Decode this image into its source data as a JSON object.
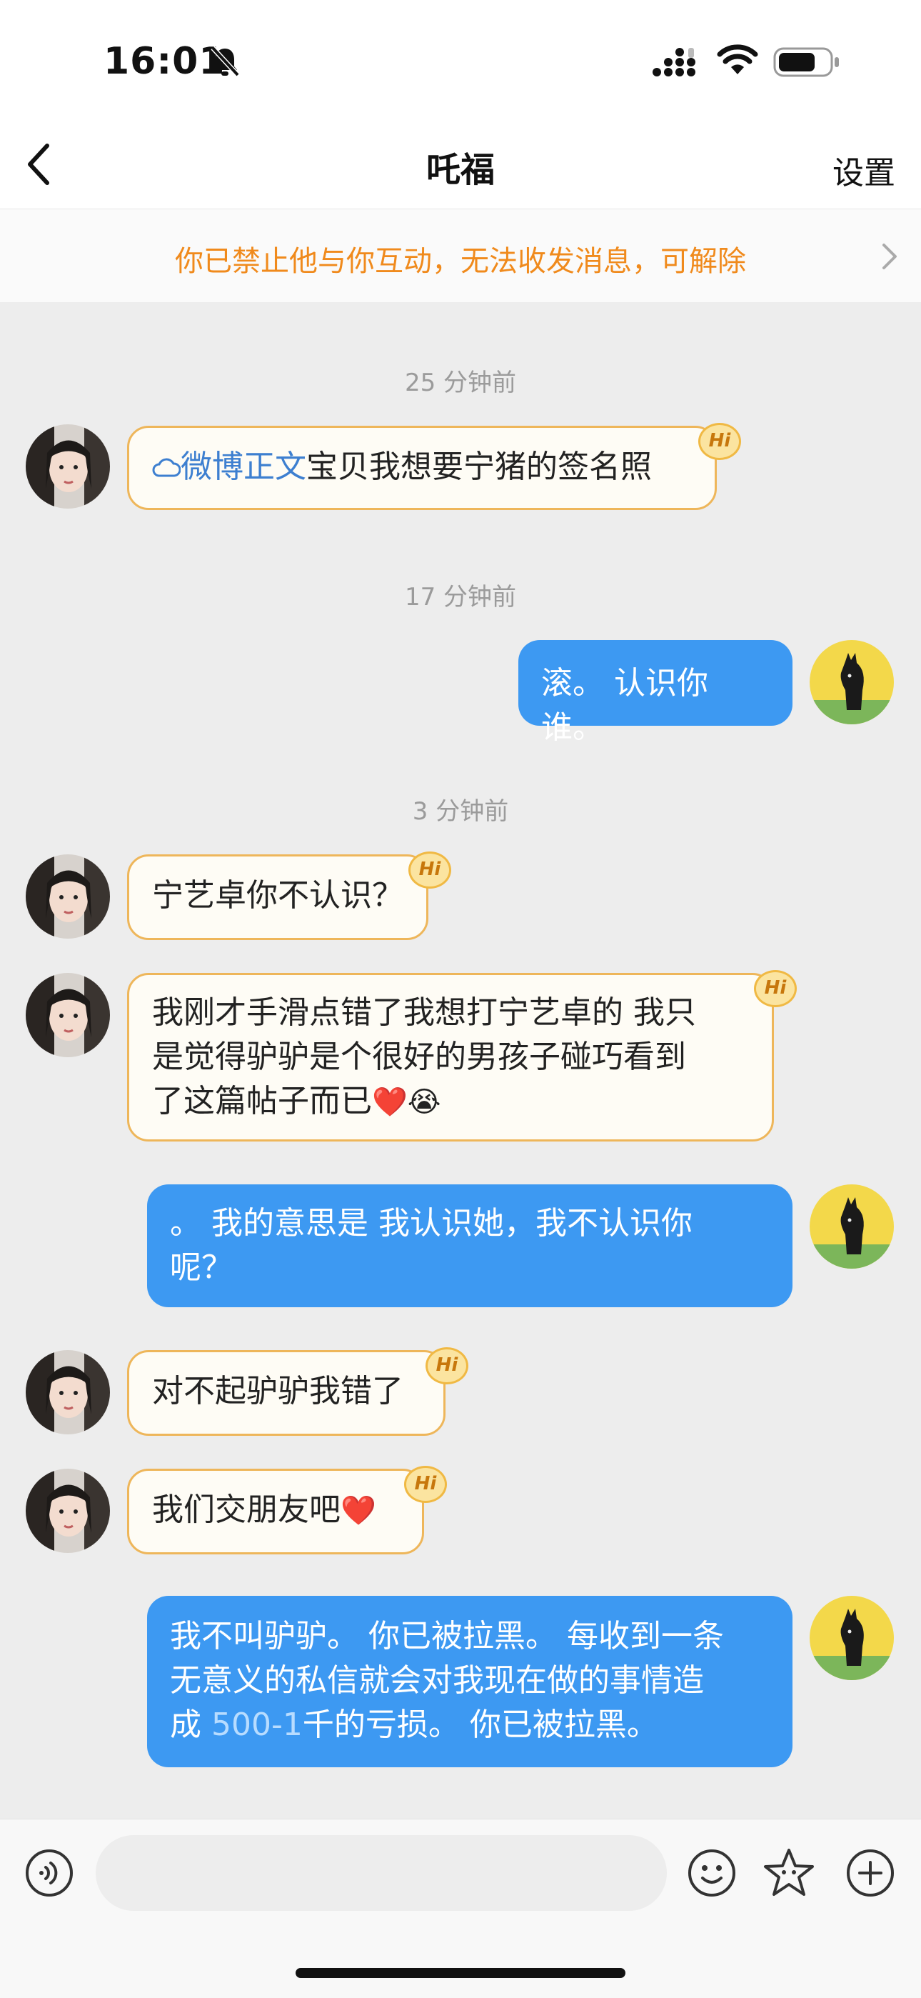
{
  "status_bar": {
    "time": "16:01"
  },
  "header": {
    "title": "吒福",
    "settings_label": "设置"
  },
  "banner": {
    "text": "你已禁止他与你互动，无法收发消息，可解除"
  },
  "messages": [
    {
      "timestamp": "25 分钟前"
    },
    {
      "side": "in",
      "link": "微博正文",
      "text": "宝贝我想要宁猪的签名照",
      "badge": "Hi"
    },
    {
      "timestamp": "17 分钟前"
    },
    {
      "side": "out",
      "text": "滚。 认识你谁。"
    },
    {
      "timestamp": "3 分钟前"
    },
    {
      "side": "in",
      "text": "宁艺卓你不认识？",
      "badge": "Hi"
    },
    {
      "side": "in",
      "line1": "我刚才手滑点错了我想打宁艺卓的 我只",
      "line2": "是觉得驴驴是个很好的男孩子碰巧看到",
      "line3": "了这篇帖子而已",
      "emojis": "❤️😭",
      "badge": "Hi"
    },
    {
      "side": "out",
      "line1": "。 我的意思是 我认识她，我不认识你",
      "line2": "呢？"
    },
    {
      "side": "in",
      "text": "对不起驴驴我错了",
      "badge": "Hi"
    },
    {
      "side": "in",
      "text": "我们交朋友吧",
      "emojis": "❤️",
      "badge": "Hi"
    },
    {
      "side": "out",
      "line1": "我不叫驴驴。 你已被拉黑。 每收到一条",
      "line2": "无意义的私信就会对我现在做的事情造",
      "line3_pre": "成 ",
      "line3_num": "500-1",
      "line3_post": "千的亏损。 你已被拉黑。"
    }
  ],
  "colors": {
    "incoming_border": "#eeb65a",
    "outgoing_bg": "#3d99f2",
    "banner_text": "#f08a1c"
  },
  "icons": [
    "back-chevron-icon",
    "bell-muted-icon",
    "signal-icon",
    "wifi-icon",
    "battery-icon",
    "voice-icon",
    "emoji-icon",
    "sticker-icon",
    "plus-icon"
  ]
}
